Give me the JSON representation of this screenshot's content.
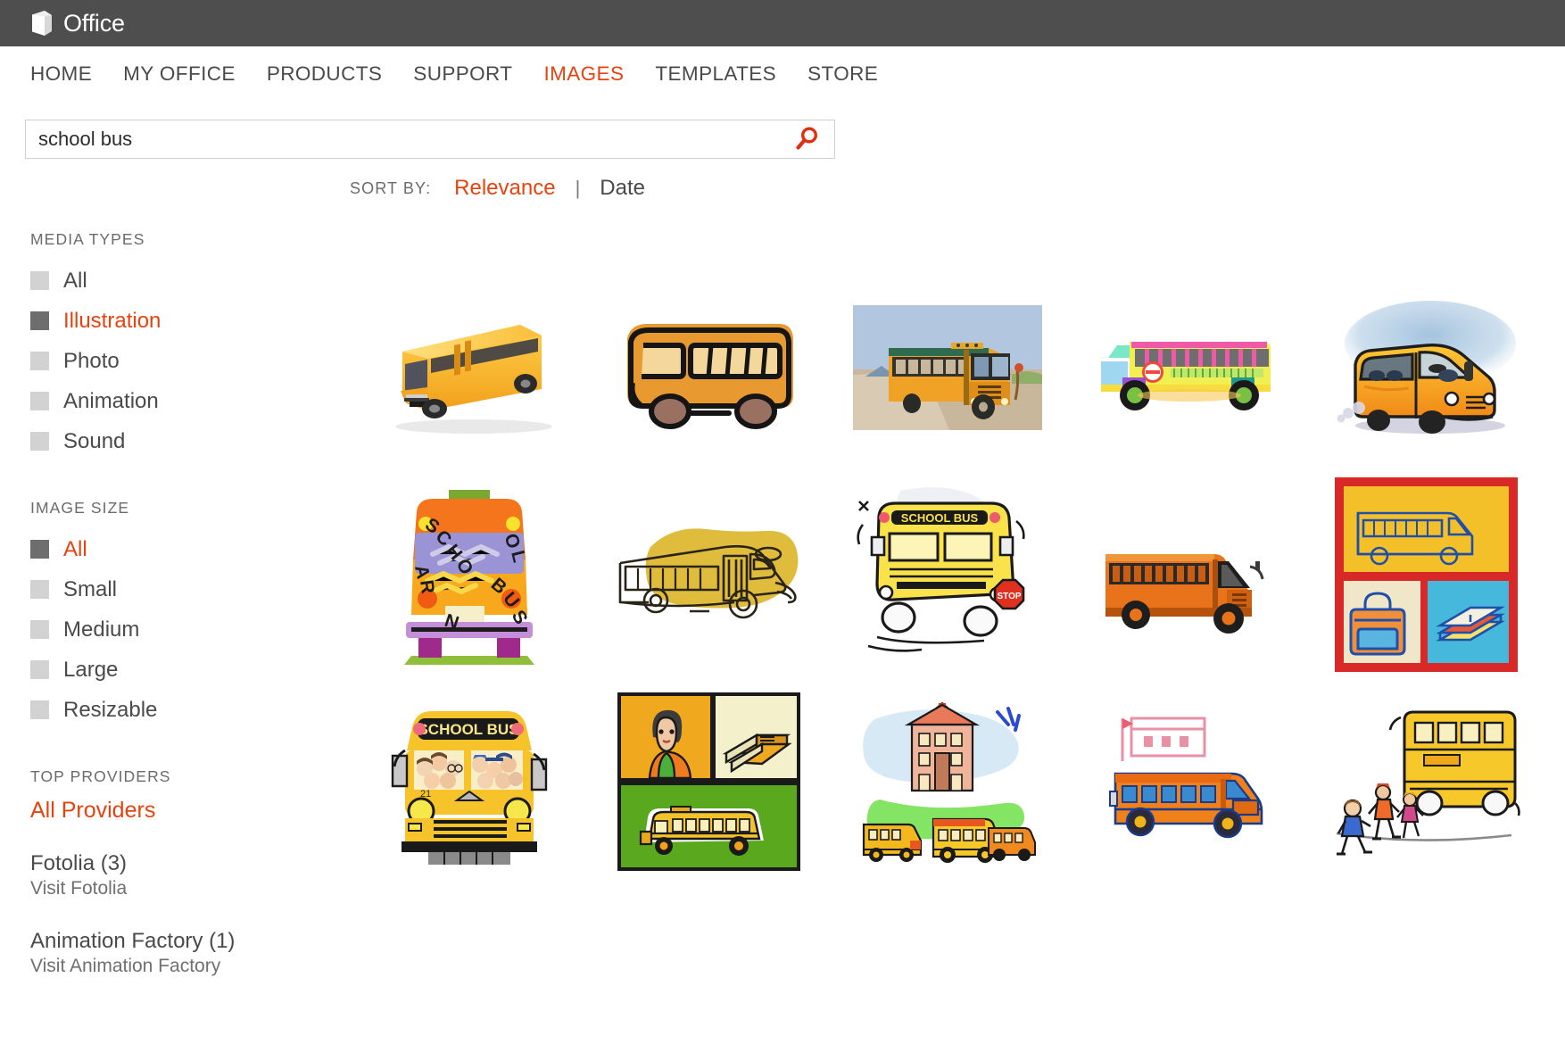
{
  "brand": {
    "wordmark": "Office",
    "logo_icon": "office-logo-icon",
    "accent_color": "#e8430f",
    "bar_color": "#4e4e4e"
  },
  "nav": {
    "items": [
      {
        "label": "HOME",
        "active": false
      },
      {
        "label": "MY OFFICE",
        "active": false
      },
      {
        "label": "PRODUCTS",
        "active": false
      },
      {
        "label": "SUPPORT",
        "active": false
      },
      {
        "label": "IMAGES",
        "active": true
      },
      {
        "label": "TEMPLATES",
        "active": false
      },
      {
        "label": "STORE",
        "active": false
      }
    ]
  },
  "search": {
    "value": "school bus",
    "placeholder": "Search images",
    "button_icon": "search-icon",
    "icon_color": "#e03010"
  },
  "sidebar": {
    "media_types": {
      "title": "MEDIA TYPES",
      "items": [
        {
          "label": "All",
          "selected": false
        },
        {
          "label": "Illustration",
          "selected": true
        },
        {
          "label": "Photo",
          "selected": false
        },
        {
          "label": "Animation",
          "selected": false
        },
        {
          "label": "Sound",
          "selected": false
        }
      ]
    },
    "image_size": {
      "title": "IMAGE SIZE",
      "items": [
        {
          "label": "All",
          "selected": true
        },
        {
          "label": "Small",
          "selected": false
        },
        {
          "label": "Medium",
          "selected": false
        },
        {
          "label": "Large",
          "selected": false
        },
        {
          "label": "Resizable",
          "selected": false
        }
      ]
    },
    "top_providers": {
      "title": "TOP PROVIDERS",
      "all_label": "All Providers",
      "items": [
        {
          "name": "Fotolia (3)",
          "visit": "Visit Fotolia"
        },
        {
          "name": "Animation Factory (1)",
          "visit": "Visit Animation Factory"
        }
      ]
    }
  },
  "sort": {
    "label": "SORT BY:",
    "separator": "|",
    "options": [
      {
        "label": "Relevance",
        "active": true
      },
      {
        "label": "Date",
        "active": false
      }
    ]
  },
  "results": {
    "count": 15,
    "thumbnails": [
      {
        "name": "thumb-3d-yellow-school-bus-angled",
        "alt": "3D rendered yellow school bus, angled front-left view",
        "style": "render-3d"
      },
      {
        "name": "thumb-sketchy-orange-bus-outline",
        "alt": "Hand-drawn orange bus with thick black outline",
        "style": "marker-sketch"
      },
      {
        "name": "thumb-school-bus-on-desert-road",
        "alt": "School bus on a road with blue sky and mountains",
        "style": "scene-flat"
      },
      {
        "name": "thumb-rainbow-multicolor-bus",
        "alt": "Brightly multicolored pink green yellow bus side view",
        "style": "flat-colorful"
      },
      {
        "name": "thumb-watercolor-yellow-bus",
        "alt": "Painterly watercolor yellow bus with blue sky wash",
        "style": "watercolor"
      },
      {
        "name": "thumb-front-view-stylized-school-bus",
        "alt": "Stylized front view bus with curved SCHOOL BUS lettering",
        "style": "abstract-front"
      },
      {
        "name": "thumb-line-art-bus-on-gold-blob",
        "alt": "Line art bus sketch over a mustard yellow blob",
        "style": "lineart-blob"
      },
      {
        "name": "thumb-cartoon-bus-with-stop-sign",
        "alt": "Bouncy cartoon school bus with red STOP sign",
        "style": "cartoon-stop"
      },
      {
        "name": "thumb-orange-bus-three-quarter",
        "alt": "Orange school bus three-quarter front view",
        "style": "flat-orange"
      },
      {
        "name": "thumb-school-collage-bus-backpack-books",
        "alt": "Collage panel with bus, backpack and books on red",
        "style": "collage-red"
      },
      {
        "name": "thumb-school-bus-full-of-children",
        "alt": "Front view cartoon school bus packed with children",
        "style": "kids-bus"
      },
      {
        "name": "thumb-panel-teacher-books-bus",
        "alt": "Three panel collage: teacher, stacked books, school bus",
        "style": "collage-green"
      },
      {
        "name": "thumb-schoolhouse-with-buses",
        "alt": "Schoolhouse building with two buses in front",
        "style": "school-scene"
      },
      {
        "name": "thumb-bus-in-front-of-school",
        "alt": "Orange bus parked in front of a pink school building",
        "style": "bus-school"
      },
      {
        "name": "thumb-kids-running-to-bus",
        "alt": "Children running toward a yellow school bus",
        "style": "kids-running"
      }
    ]
  }
}
